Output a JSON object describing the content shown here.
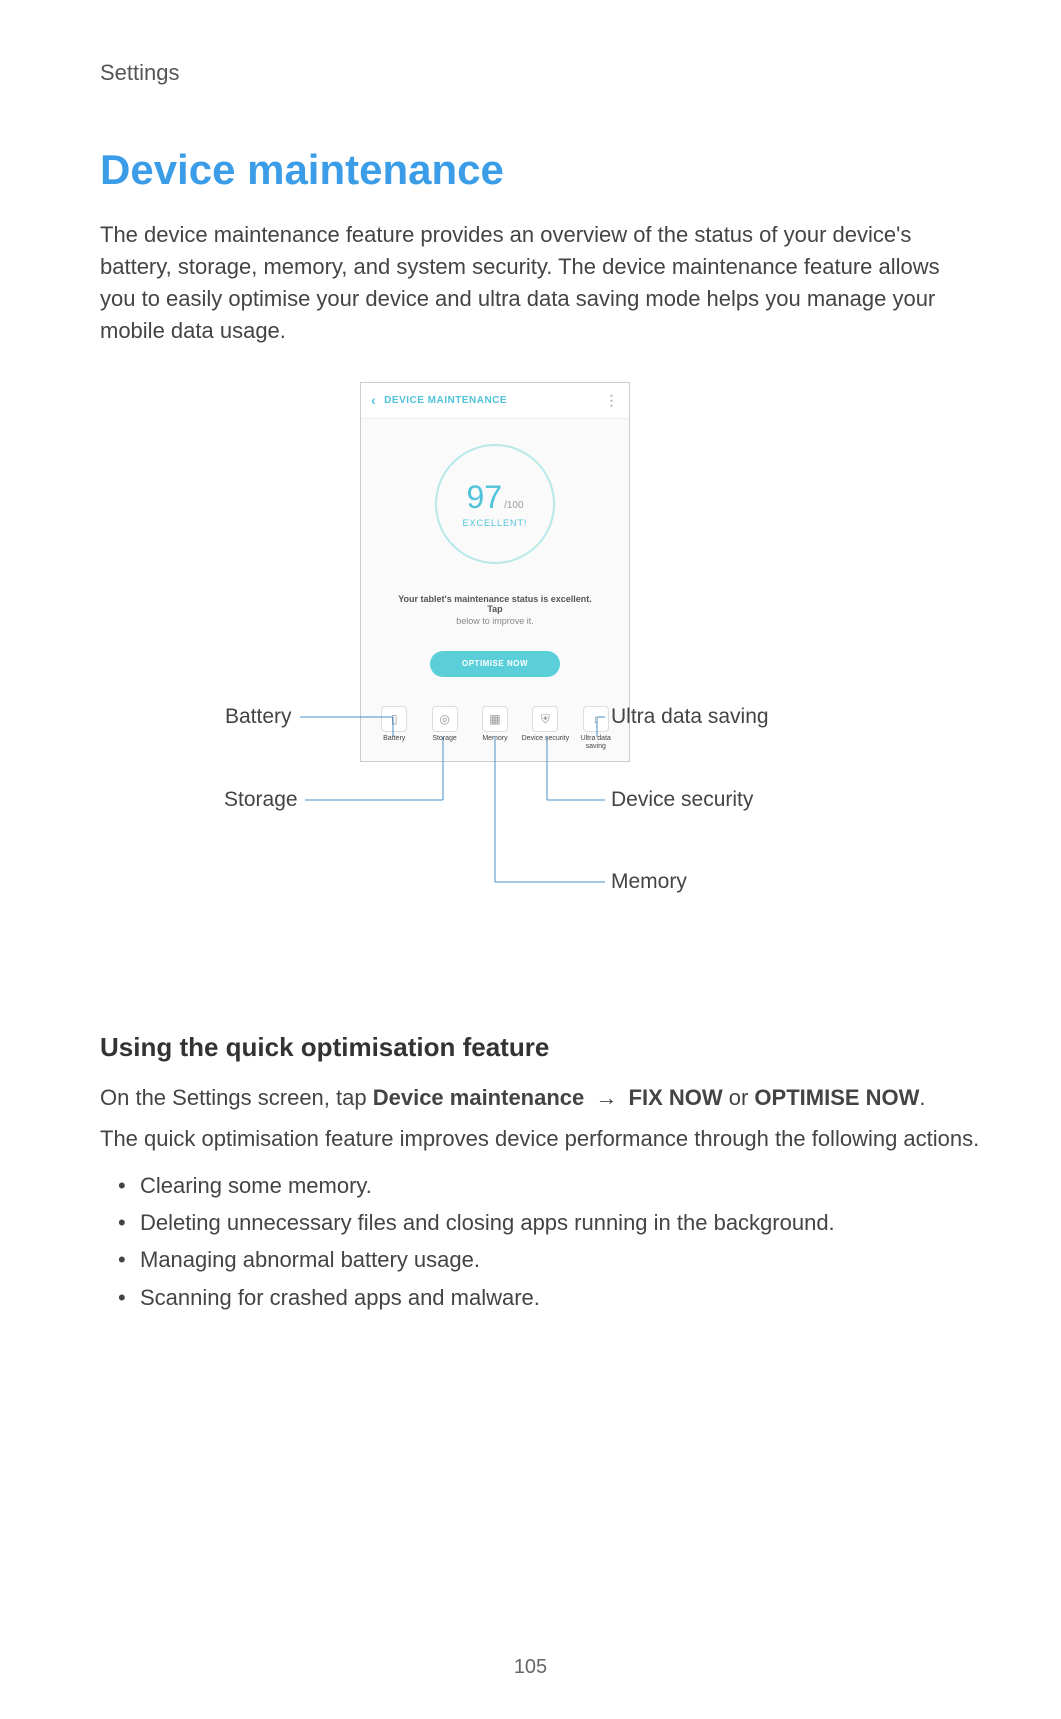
{
  "breadcrumb": "Settings",
  "title": "Device maintenance",
  "intro": "The device maintenance feature provides an overview of the status of your device's battery, storage, memory, and system security. The device maintenance feature allows you to easily optimise your device and ultra data saving mode helps you manage your mobile data usage.",
  "phone": {
    "header": "DEVICE MAINTENANCE",
    "score": "97",
    "score_max": "/100",
    "score_label": "EXCELLENT!",
    "status1": "Your tablet's maintenance status is excellent. Tap",
    "status2": "below to improve it.",
    "button": "OPTIMISE NOW",
    "icons": [
      {
        "label": "Battery"
      },
      {
        "label": "Storage"
      },
      {
        "label": "Memory"
      },
      {
        "label": "Device security"
      },
      {
        "label": "Ultra data saving"
      }
    ]
  },
  "callouts": {
    "battery": "Battery",
    "storage": "Storage",
    "ultra": "Ultra data saving",
    "security": "Device security",
    "memory": "Memory"
  },
  "section_title": "Using the quick optimisation feature",
  "instruction_prefix": "On the Settings screen, tap ",
  "instruction_bold1": "Device maintenance",
  "instruction_arrow": "→",
  "instruction_bold2": "FIX NOW",
  "instruction_or": " or ",
  "instruction_bold3": "OPTIMISE NOW",
  "instruction_suffix": ".",
  "body2": "The quick optimisation feature improves device performance through the following actions.",
  "bullets": [
    "Clearing some memory.",
    "Deleting unnecessary files and closing apps running in the background.",
    "Managing abnormal battery usage.",
    "Scanning for crashed apps and malware."
  ],
  "page_number": "105"
}
